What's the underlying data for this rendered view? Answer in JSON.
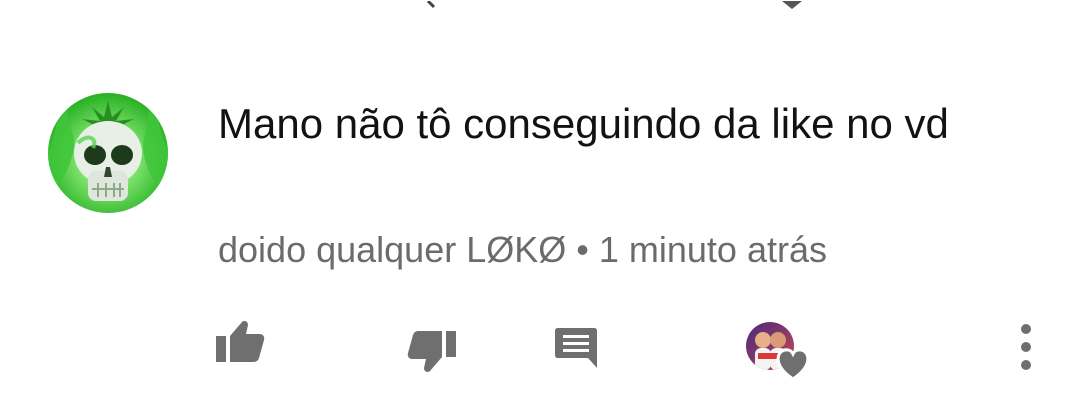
{
  "comment": {
    "text": "Mano não tô conseguindo da like no vd",
    "author": "doido qualquer LØKØ",
    "separator": "•",
    "timestamp": "1 minuto atrás",
    "avatar_icon": "green-skull-avatar"
  },
  "actions": {
    "like_icon": "thumbs-up-icon",
    "dislike_icon": "thumbs-down-icon",
    "reply_icon": "reply-comment-icon",
    "creator_heart_icon": "creator-heart-icon",
    "more_icon": "more-vertical-icon"
  },
  "colors": {
    "text": "#121212",
    "meta": "#6b6b6b",
    "icon": "#6f6f6f",
    "avatar_green": "#2fb52a"
  }
}
